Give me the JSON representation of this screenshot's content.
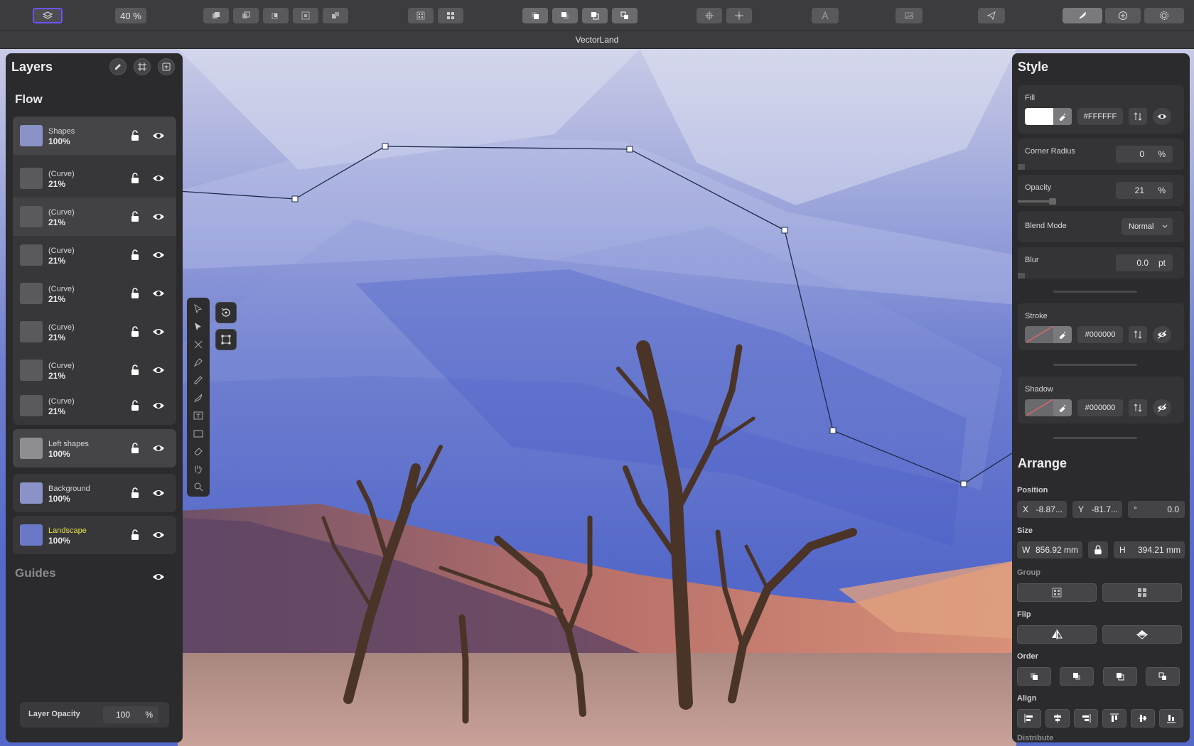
{
  "toolbar": {
    "zoom": "40 %"
  },
  "window": {
    "title": "VectorLand"
  },
  "layers_panel": {
    "title": "Layers",
    "group_title": "Flow",
    "guides_title": "Guides",
    "layers": [
      {
        "name": "Shapes",
        "value": "100%"
      },
      {
        "name": "(Curve)",
        "value": "21%"
      },
      {
        "name": "(Curve)",
        "value": "21%"
      },
      {
        "name": "(Curve)",
        "value": "21%"
      },
      {
        "name": "(Curve)",
        "value": "21%"
      },
      {
        "name": "(Curve)",
        "value": "21%"
      },
      {
        "name": "(Curve)",
        "value": "21%"
      },
      {
        "name": "(Curve)",
        "value": "21%"
      }
    ],
    "left_shapes": {
      "name": "Left shapes",
      "value": "100%"
    },
    "background": {
      "name": "Background",
      "value": "100%"
    },
    "landscape": {
      "name": "Landscape",
      "value": "100%"
    },
    "layer_opacity": {
      "label": "Layer Opacity",
      "value": "100",
      "unit": "%"
    }
  },
  "style_panel": {
    "title": "Style",
    "fill": {
      "label": "Fill",
      "hex": "#FFFFFF"
    },
    "corner_radius": {
      "label": "Corner Radius",
      "value": "0",
      "unit": "%"
    },
    "opacity": {
      "label": "Opacity",
      "value": "21",
      "unit": "%"
    },
    "blend_mode": {
      "label": "Blend Mode",
      "value": "Normal"
    },
    "blur": {
      "label": "Blur",
      "value": "0.0",
      "unit": "pt"
    },
    "stroke": {
      "label": "Stroke",
      "hex": "#000000"
    },
    "shadow": {
      "label": "Shadow",
      "hex": "#000000"
    }
  },
  "arrange_panel": {
    "title": "Arrange",
    "position": {
      "label": "Position",
      "x_label": "X",
      "x": "-8.87...",
      "y_label": "Y",
      "y": "-81.7...",
      "angle_label": "°",
      "angle": "0.0"
    },
    "size": {
      "label": "Size",
      "w_label": "W",
      "w": "856.92 mm",
      "h_label": "H",
      "h": "394.21 mm"
    },
    "group_label": "Group",
    "flip_label": "Flip",
    "order_label": "Order",
    "align_label": "Align",
    "distribute_label": "Distribute"
  },
  "colors": {
    "accent": "#5b4fd6",
    "landscape_label": "#e6e04a"
  }
}
